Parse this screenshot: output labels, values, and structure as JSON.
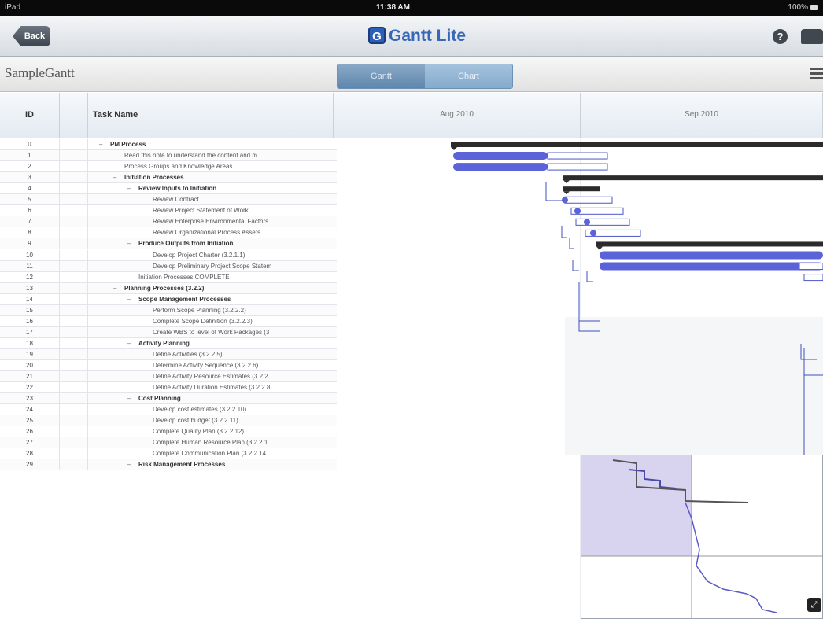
{
  "statusbar": {
    "carrier": "iPad",
    "time": "11:38 AM",
    "battery": "100%"
  },
  "navbar": {
    "back_label": "Back",
    "logo_glyph": "G",
    "title": "Gantt Lite",
    "help_glyph": "?",
    "help_icon": "help-icon",
    "inbox_icon": "inbox-icon"
  },
  "toolbar": {
    "doc_title": "SampleGantt",
    "segments": [
      "Gantt",
      "Chart"
    ],
    "menu_icon": "list-icon"
  },
  "grid": {
    "id_header": "ID",
    "name_header": "Task Name",
    "months": [
      "Aug 2010",
      "Sep 2010"
    ]
  },
  "tasks": [
    {
      "id": "0",
      "name": "PM Process",
      "level": 0,
      "summary": true
    },
    {
      "id": "1",
      "name": "Read this note to understand the content and m",
      "level": 1,
      "summary": false
    },
    {
      "id": "2",
      "name": "Process Groups and Knowledge Areas",
      "level": 1,
      "summary": false
    },
    {
      "id": "3",
      "name": "Initiation Processes",
      "level": 1,
      "summary": true
    },
    {
      "id": "4",
      "name": "Review Inputs to Initiation",
      "level": 2,
      "summary": true
    },
    {
      "id": "5",
      "name": "Review Contract",
      "level": 3,
      "summary": false
    },
    {
      "id": "6",
      "name": "Review Project Statement of Work",
      "level": 3,
      "summary": false
    },
    {
      "id": "7",
      "name": "Review Enterprise Environmental Factors",
      "level": 3,
      "summary": false
    },
    {
      "id": "8",
      "name": "Review Organizational Process Assets",
      "level": 3,
      "summary": false
    },
    {
      "id": "9",
      "name": "Produce Outputs from Initiation",
      "level": 2,
      "summary": true
    },
    {
      "id": "10",
      "name": "Develop Project Charter (3.2.1.1)",
      "level": 3,
      "summary": false
    },
    {
      "id": "11",
      "name": "Develop Preliminary Project Scope Statem",
      "level": 3,
      "summary": false
    },
    {
      "id": "12",
      "name": "Initiation Processes COMPLETE",
      "level": 2,
      "summary": false
    },
    {
      "id": "13",
      "name": "Planning Processes (3.2.2)",
      "level": 1,
      "summary": true
    },
    {
      "id": "14",
      "name": "Scope Management Processes",
      "level": 2,
      "summary": true
    },
    {
      "id": "15",
      "name": "Perform Scope Planning (3.2.2.2)",
      "level": 3,
      "summary": false
    },
    {
      "id": "16",
      "name": "Complete Scope Definition (3.2.2.3)",
      "level": 3,
      "summary": false
    },
    {
      "id": "17",
      "name": "Create WBS to level of Work Packages (3",
      "level": 3,
      "summary": false
    },
    {
      "id": "18",
      "name": "Activity Planning",
      "level": 2,
      "summary": true
    },
    {
      "id": "19",
      "name": "Define Activities (3.2.2.5)",
      "level": 3,
      "summary": false
    },
    {
      "id": "20",
      "name": "Determine Activity Sequence (3.2.2.6)",
      "level": 3,
      "summary": false
    },
    {
      "id": "21",
      "name": "Define Activity Resource Estimates (3.2.2.",
      "level": 3,
      "summary": false
    },
    {
      "id": "22",
      "name": "Define Activity Duration Estimates (3.2.2.8",
      "level": 3,
      "summary": false
    },
    {
      "id": "23",
      "name": "Cost Planning",
      "level": 2,
      "summary": true
    },
    {
      "id": "24",
      "name": "Develop cost estimates (3.2.2.10)",
      "level": 3,
      "summary": false
    },
    {
      "id": "25",
      "name": "Develop cost budget (3.2.2.11)",
      "level": 3,
      "summary": false
    },
    {
      "id": "26",
      "name": "Complete Quality Plan (3.2.2.12)",
      "level": 3,
      "summary": false
    },
    {
      "id": "27",
      "name": "Complete Human Resource Plan (3.2.2.1",
      "level": 3,
      "summary": false
    },
    {
      "id": "28",
      "name": "Complete Communication Plan (3.2.2.14",
      "level": 3,
      "summary": false
    },
    {
      "id": "29",
      "name": "Risk Management Processes",
      "level": 2,
      "summary": true
    }
  ],
  "colors": {
    "bar_fill": "#5a63d8",
    "bar_outline": "#4a57c9",
    "summary_bar": "#2b2b2b",
    "link_line": "#3f4fbf",
    "minimap_bg": "#d8d3ef"
  },
  "expand_icon": "expand-icon"
}
